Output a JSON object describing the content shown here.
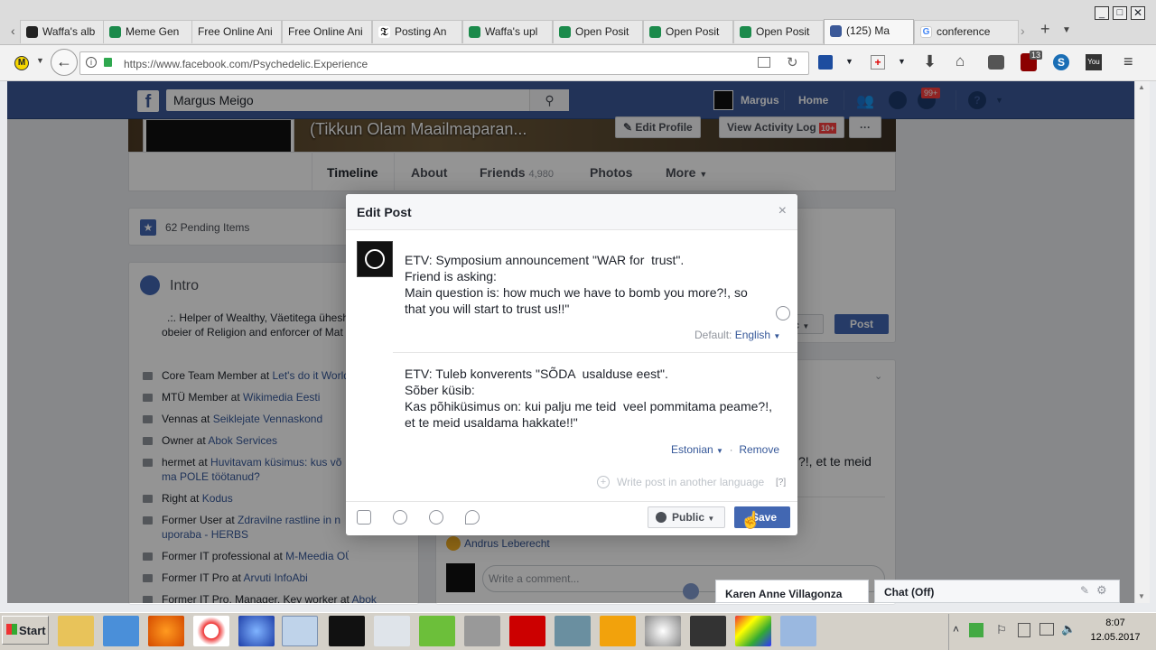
{
  "browser": {
    "tabs": [
      {
        "label": "Waffa's alb"
      },
      {
        "label": "Meme Gen"
      },
      {
        "label": "Free Online Ani"
      },
      {
        "label": "Free Online Ani"
      },
      {
        "label": "Posting An"
      },
      {
        "label": "Waffa's upl"
      },
      {
        "label": "Open Posit"
      },
      {
        "label": "Open Posit"
      },
      {
        "label": "Open Posit"
      },
      {
        "label": "(125) Ma"
      },
      {
        "label": "conference"
      }
    ],
    "url": "https://www.facebook.com/Psychedelic.Experience",
    "badge_count": "13"
  },
  "fb_header": {
    "search_value": "Margus Meigo",
    "user_name": "Margus",
    "home": "Home",
    "notif_badge": "99+"
  },
  "profile": {
    "cover_name": "(Tikkun Olam Maailmaparan...",
    "edit_profile": "Edit Profile",
    "activity_log": "View Activity Log",
    "activity_badge": "10+",
    "more_dots": "···",
    "nav": {
      "timeline": "Timeline",
      "about": "About",
      "friends": "Friends",
      "friends_count": "4,980",
      "photos": "Photos",
      "more": "More"
    }
  },
  "sidebar": {
    "pending": "62 Pending Items",
    "intro_title": "Intro",
    "intro_text_1": ".:. Helper of Wealthy, Väetitega üheshi",
    "intro_text_2": "obeier of Religion and enforcer of Mat",
    "items": [
      {
        "pre": "Core Team Member at ",
        "link": "Let's do it World"
      },
      {
        "pre": "MTÜ Member at ",
        "link": "Wikimedia Eesti"
      },
      {
        "pre": "Vennas at ",
        "link": "Seiklejate Vennaskond"
      },
      {
        "pre": "Owner at ",
        "link": "Abok Services"
      },
      {
        "pre": "hermet at ",
        "link": "Huvitavam küsimus: kus võ"
      },
      {
        "pre": "",
        "link": "ma POLE töötanud?"
      },
      {
        "pre": "Right at ",
        "link": "Kodus"
      },
      {
        "pre": "Former User at ",
        "link": "Zdravilne rastline in n"
      },
      {
        "pre": "",
        "link": "uporaba - HERBS"
      },
      {
        "pre": "Former IT professional at ",
        "link": "M-Meedia OÜ"
      },
      {
        "pre": "Former IT Pro at ",
        "link": "Arvuti InfoAbi"
      },
      {
        "pre": "Former IT Pro, Manager, Key worker at ",
        "link": "Abok"
      }
    ]
  },
  "feed": {
    "post_btn": "Post",
    "partial_btn": "ic",
    "right_text": "?!, et te meid",
    "commenter": "Andrus Leberecht",
    "comment_placeholder": "Write a comment..."
  },
  "modal": {
    "title": "Edit Post",
    "close": "×",
    "text_en": "ETV: Symposium announcement \"WAR for  trust\".\nFriend is asking:\nMain question is: how much we have to bomb you more?!, so\nthat you will start to trust us!!\"",
    "default_label": "Default:",
    "default_lang": "English",
    "text_et": "ETV: Tuleb konverents \"SÕDA  usalduse eest\".\nSõber küsib:\nKas põhiküsimus on: kui palju me teid  veel pommitama peame?!,\net te meid usaldama hakkate!!\"",
    "second_lang": "Estonian",
    "separator": "·",
    "remove": "Remove",
    "write_another": "Write post in another language",
    "help": "[?]",
    "public": "Public",
    "save": "Save"
  },
  "chat": {
    "karen": "Karen Anne Villagonza",
    "chat_off": "Chat (Off)"
  },
  "taskbar": {
    "start": "Start",
    "time": "8:07",
    "date": "12.05.2017"
  }
}
